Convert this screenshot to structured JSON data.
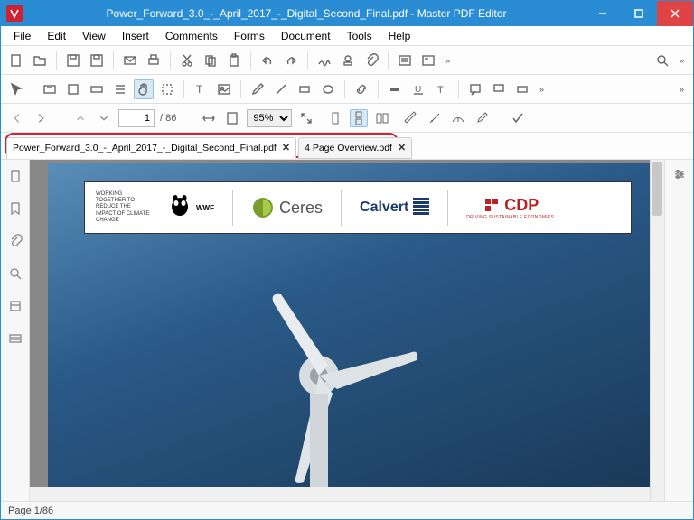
{
  "window": {
    "title": "Power_Forward_3.0_-_April_2017_-_Digital_Second_Final.pdf - Master PDF Editor"
  },
  "menu": {
    "items": [
      "File",
      "Edit",
      "View",
      "Insert",
      "Comments",
      "Forms",
      "Document",
      "Tools",
      "Help"
    ]
  },
  "nav": {
    "page_current": "1",
    "page_total": "/ 86",
    "zoom": "95%"
  },
  "tabs": [
    {
      "label": "Power_Forward_3.0_-_April_2017_-_Digital_Second_Final.pdf",
      "active": true
    },
    {
      "label": "4 Page Overview.pdf",
      "active": false
    }
  ],
  "document": {
    "banner_text": "WORKING TOGETHER TO REDUCE THE IMPACT OF CLIMATE CHANGE",
    "logos": {
      "wwf": "WWF",
      "ceres": "Ceres",
      "calvert": "Calvert",
      "cdp": "CDP",
      "cdp_tag": "DRIVING SUSTAINABLE ECONOMIES"
    }
  },
  "status": {
    "page": "Page 1/86"
  }
}
